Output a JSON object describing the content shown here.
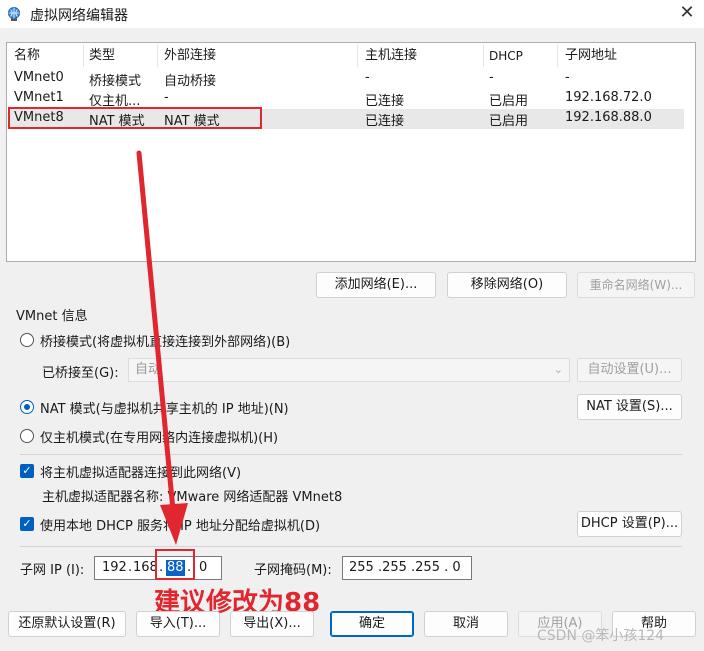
{
  "window": {
    "title": "虚拟网络编辑器",
    "close": "✕"
  },
  "table": {
    "headers": [
      "名称",
      "类型",
      "外部连接",
      "主机连接",
      "DHCP",
      "子网地址"
    ],
    "rows": [
      [
        "VMnet0",
        "桥接模式",
        "自动桥接",
        "-",
        "-",
        "-"
      ],
      [
        "VMnet1",
        "仅主机...",
        "-",
        "已连接",
        "已启用",
        "192.168.72.0"
      ],
      [
        "VMnet8",
        "NAT 模式",
        "NAT 模式",
        "已连接",
        "已启用",
        "192.168.88.0"
      ]
    ],
    "selected_row": 2
  },
  "list_buttons": {
    "add": "添加网络(E)...",
    "remove": "移除网络(O)",
    "rename": "重命名网络(W)..."
  },
  "vmnet_info": {
    "group_title": "VMnet 信息",
    "bridged_label": "桥接模式(将虚拟机直接连接到外部网络)(B)",
    "bridged_to_label": "已桥接至(G):",
    "bridged_to_value": "自动",
    "auto_settings": "自动设置(U)...",
    "nat_label": "NAT 模式(与虚拟机共享主机的 IP 地址)(N)",
    "nat_settings": "NAT 设置(S)...",
    "hostonly_label": "仅主机模式(在专用网络内连接虚拟机)(H)",
    "connect_adapter_label": "将主机虚拟适配器连接到此网络(V)",
    "adapter_name_label": "主机虚拟适配器名称: VMware 网络适配器 VMnet8",
    "dhcp_label": "使用本地 DHCP 服务将 IP 地址分配给虚拟机(D)",
    "dhcp_settings": "DHCP 设置(P)...",
    "selected_mode": "nat",
    "connect_adapter_checked": true,
    "dhcp_checked": true
  },
  "subnet": {
    "ip_label": "子网 IP (I):",
    "ip_octets": [
      "192",
      "168",
      "88",
      "0"
    ],
    "mask_label": "子网掩码(M):",
    "mask_value": "255 .255 .255 . 0"
  },
  "annotation": {
    "text": "建议修改为88",
    "color": "#e0262e"
  },
  "bottom_buttons": {
    "restore": "还原默认设置(R)",
    "import": "导入(T)...",
    "export": "导出(X)...",
    "ok": "确定",
    "cancel": "取消",
    "apply": "应用(A)",
    "help": "帮助"
  },
  "watermark": "CSDN @笨小孩124"
}
